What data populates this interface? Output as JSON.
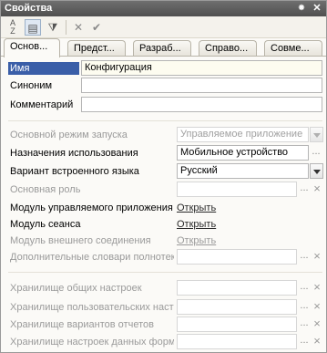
{
  "window": {
    "title": "Свойства",
    "pin_icon": "pin-icon",
    "close_icon": "close-icon"
  },
  "toolbar": {
    "items": [
      "sort-alpha-icon",
      "categories-icon",
      "filter-icon",
      "delete-icon",
      "check-icon"
    ]
  },
  "tabs": [
    "Основ...",
    "Предст...",
    "Разраб...",
    "Справо...",
    "Совме..."
  ],
  "main": {
    "name_label": "Имя",
    "name_value": "Конфигурация",
    "synonym_label": "Синоним",
    "synonym_value": "",
    "comment_label": "Комментарий",
    "comment_value": "",
    "launch_mode_label": "Основной режим запуска",
    "launch_mode_value": "Управляемое приложение",
    "usage_label": "Назначения использования",
    "usage_value": "Мобильное устройство",
    "lang_label": "Вариант встроенного языка",
    "lang_value": "Русский",
    "role_label": "Основная роль",
    "role_value": "",
    "managed_app_label": "Модуль управляемого приложения",
    "managed_app_link": "Открыть",
    "session_label": "Модуль сеанса",
    "session_link": "Открыть",
    "external_label": "Модуль внешнего соединения",
    "external_link": "Открыть",
    "fulltext_label": "Дополнительные словари полнотекстового поиска",
    "storage_common_label": "Хранилище общих настроек",
    "storage_user_label": "Хранилище пользовательских настроек",
    "storage_variants_label": "Хранилище вариантов отчетов",
    "storage_form_label": "Хранилище настроек данных форм",
    "ellipsis": "...",
    "clear": "×"
  }
}
